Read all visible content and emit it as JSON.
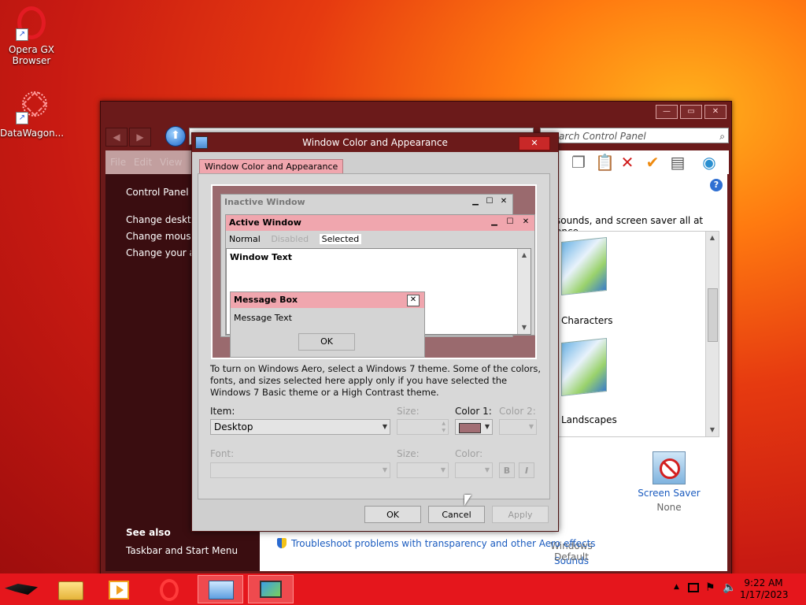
{
  "desktop": {
    "icons": [
      {
        "label": "Opera GX Browser",
        "icon": "opera-gx-icon"
      },
      {
        "label": "DataWagon...",
        "icon": "datawagon-icon"
      }
    ]
  },
  "control_panel": {
    "search_placeholder": "Search Control Panel",
    "menu": [
      "File",
      "Edit",
      "View"
    ],
    "sidebar": {
      "home": "Control Panel Home",
      "links": [
        "Change desktop icons",
        "Change mouse pointers",
        "Change your account picture"
      ],
      "see_also_heading": "See also",
      "see_also_links": [
        "Taskbar and Start Menu"
      ]
    },
    "content": {
      "intro": "sounds, and screen saver all at once.",
      "list_labels": [
        "Characters",
        "Landscapes"
      ],
      "bottom_items": [
        {
          "label": "Sounds",
          "sub": "Windows Default"
        },
        {
          "label": "Screen Saver",
          "sub": "None"
        }
      ],
      "troubleshoot_link": "Troubleshoot problems with transparency and other Aero effects"
    }
  },
  "dialog": {
    "title": "Window Color and Appearance",
    "close_label": "✕",
    "tab": "Window Color and Appearance",
    "preview": {
      "inactive_title": "Inactive Window",
      "active_title": "Active Window",
      "menu_normal": "Normal",
      "menu_disabled": "Disabled",
      "menu_selected": "Selected",
      "window_text": "Window Text",
      "msgbox_title": "Message Box",
      "msgbox_text": "Message Text",
      "msgbox_ok": "OK"
    },
    "info": "To turn on Windows Aero, select a Windows 7 theme.  Some of the colors, fonts, and sizes selected here apply only if you have selected the Windows 7 Basic theme or a High Contrast theme.",
    "labels": {
      "item": "Item:",
      "size": "Size:",
      "color1": "Color 1:",
      "color2": "Color 2:",
      "font": "Font:",
      "font_size": "Size:",
      "font_color": "Color:"
    },
    "item_value": "Desktop",
    "color1_hex": "#a26e74",
    "bold_label": "B",
    "italic_label": "I",
    "buttons": {
      "ok": "OK",
      "cancel": "Cancel",
      "apply": "Apply"
    }
  },
  "taskbar": {
    "time": "9:22 AM",
    "date": "1/17/2023"
  }
}
